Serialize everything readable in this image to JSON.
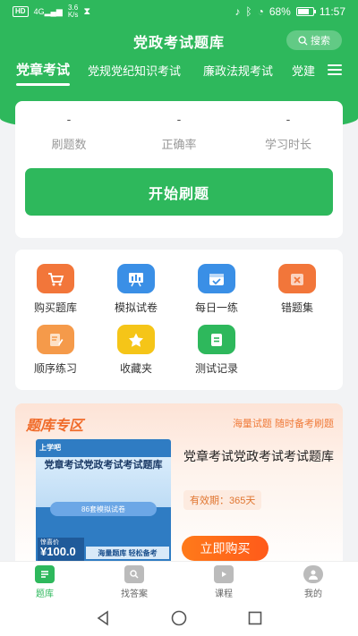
{
  "status_bar": {
    "network": "HD",
    "signal": "4G",
    "speed_value": "3.6",
    "speed_unit": "K/s",
    "battery": "68%",
    "time": "11:57"
  },
  "header": {
    "title": "党政考试题库",
    "search_label": "搜索"
  },
  "tabs": [
    {
      "label": "党章考试",
      "active": true
    },
    {
      "label": "党规党纪知识考试",
      "active": false
    },
    {
      "label": "廉政法规考试",
      "active": false
    },
    {
      "label": "党建",
      "active": false
    }
  ],
  "stats": [
    {
      "value": "-",
      "label": "刷题数"
    },
    {
      "value": "-",
      "label": "正确率"
    },
    {
      "value": "-",
      "label": "学习时长"
    }
  ],
  "start_button": "开始刷题",
  "grid": [
    {
      "label": "购买题库",
      "icon": "cart-icon",
      "color": "#f2763a"
    },
    {
      "label": "模拟试卷",
      "icon": "exam-board-icon",
      "color": "#3a8fe6"
    },
    {
      "label": "每日一练",
      "icon": "calendar-check-icon",
      "color": "#3a8fe6"
    },
    {
      "label": "错题集",
      "icon": "wrong-box-icon",
      "color": "#f2763a"
    },
    {
      "label": "顺序练习",
      "icon": "document-pencil-icon",
      "color": "#f59a4a"
    },
    {
      "label": "收藏夹",
      "icon": "star-icon",
      "color": "#f5c518"
    },
    {
      "label": "测试记录",
      "icon": "record-list-icon",
      "color": "#2eb85c"
    }
  ],
  "zone": {
    "title": "题库专区",
    "subtitle": "海量试题 随时备考刷题",
    "product": {
      "cover_logo": "上学吧",
      "cover_title": "党章考试党政考试考试题库",
      "cover_pill": "86套模拟试卷",
      "cover_price_tag": "惊喜价",
      "cover_price": "¥100.0",
      "cover_slogan": "海量题库 轻松备考",
      "title": "党章考试党政考试考试题库",
      "validity": "有效期：365天",
      "buy_label": "立即购买"
    }
  },
  "bottom_nav": [
    {
      "label": "题库",
      "icon": "question-bank-icon",
      "active": true
    },
    {
      "label": "找答案",
      "icon": "find-answer-icon",
      "active": false
    },
    {
      "label": "课程",
      "icon": "video-course-icon",
      "active": false
    },
    {
      "label": "我的",
      "icon": "user-icon",
      "active": false
    }
  ],
  "colors": {
    "primary": "#2eb85c",
    "accent_orange": "#f2763a"
  }
}
